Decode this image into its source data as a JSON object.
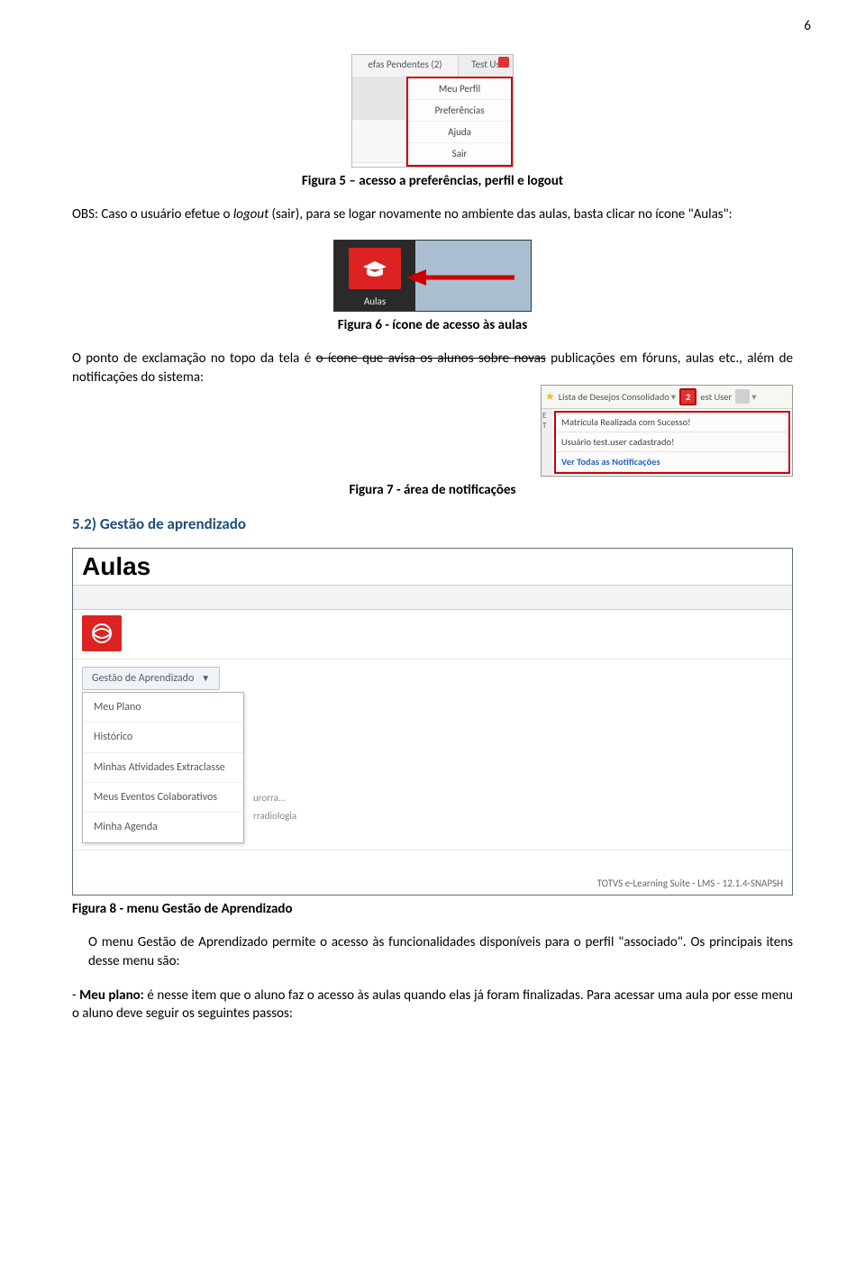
{
  "page_number": "6",
  "fig5": {
    "top_left": "efas Pendentes (2)",
    "top_right": "Test Us",
    "menu": [
      "Meu Perfil",
      "Preferências",
      "Ajuda",
      "Sair"
    ],
    "caption": "Figura 5 – acesso a preferências, perfil e logout"
  },
  "para1_pre": "OBS: Caso o usuário efetue o ",
  "para1_logout": "logout",
  "para1_post": " (sair), para se logar novamente no ambiente das aulas, basta clicar no ícone \"Aulas\":",
  "fig6": {
    "label": "Aulas",
    "caption": "Figura 6 - ícone de acesso às aulas"
  },
  "para2_pre": "O ponto de exclamação no topo da tela é ",
  "para2_strike": "o ícone que avisa os alunos sobre novas",
  "para2_post": " publicações em fóruns, aulas etc., além de notificações do sistema:",
  "fig7": {
    "top_text": "Lista de Desejos  Consolidado",
    "badge": "2",
    "user": "est User",
    "side": "E T",
    "items": [
      "Matrícula Realizada com Sucesso!",
      "Usuário  test.user  cadastrado!",
      "Ver Todas as Notificações"
    ],
    "caption": "Figura 7 - área de notificações"
  },
  "section_heading": "5.2) Gestão de aprendizado",
  "fig8": {
    "title": "Aulas",
    "dropdown_label": "Gestão de Aprendizado",
    "menu": [
      "Meu Plano",
      "Histórico",
      "Minhas Atividades Extraclasse",
      "Meus Eventos Colaborativos",
      "Minha Agenda"
    ],
    "behind1": "urorra...",
    "behind2": "rradiologia",
    "footer": "TOTVS e-Learning Suite - LMS - 12.1.4-SNAPSH",
    "caption": "Figura 8 - menu Gestão de Aprendizado"
  },
  "para3": "O menu Gestão de Aprendizado permite o acesso às funcionalidades disponíveis para o perfil \"associado\". Os principais itens desse menu são:",
  "bullet_pre": "- ",
  "bullet_bold": "Meu plano:",
  "bullet_post": " é nesse item que o aluno faz o acesso às aulas quando elas já foram finalizadas. Para acessar uma aula por esse menu o aluno deve seguir os seguintes passos:"
}
